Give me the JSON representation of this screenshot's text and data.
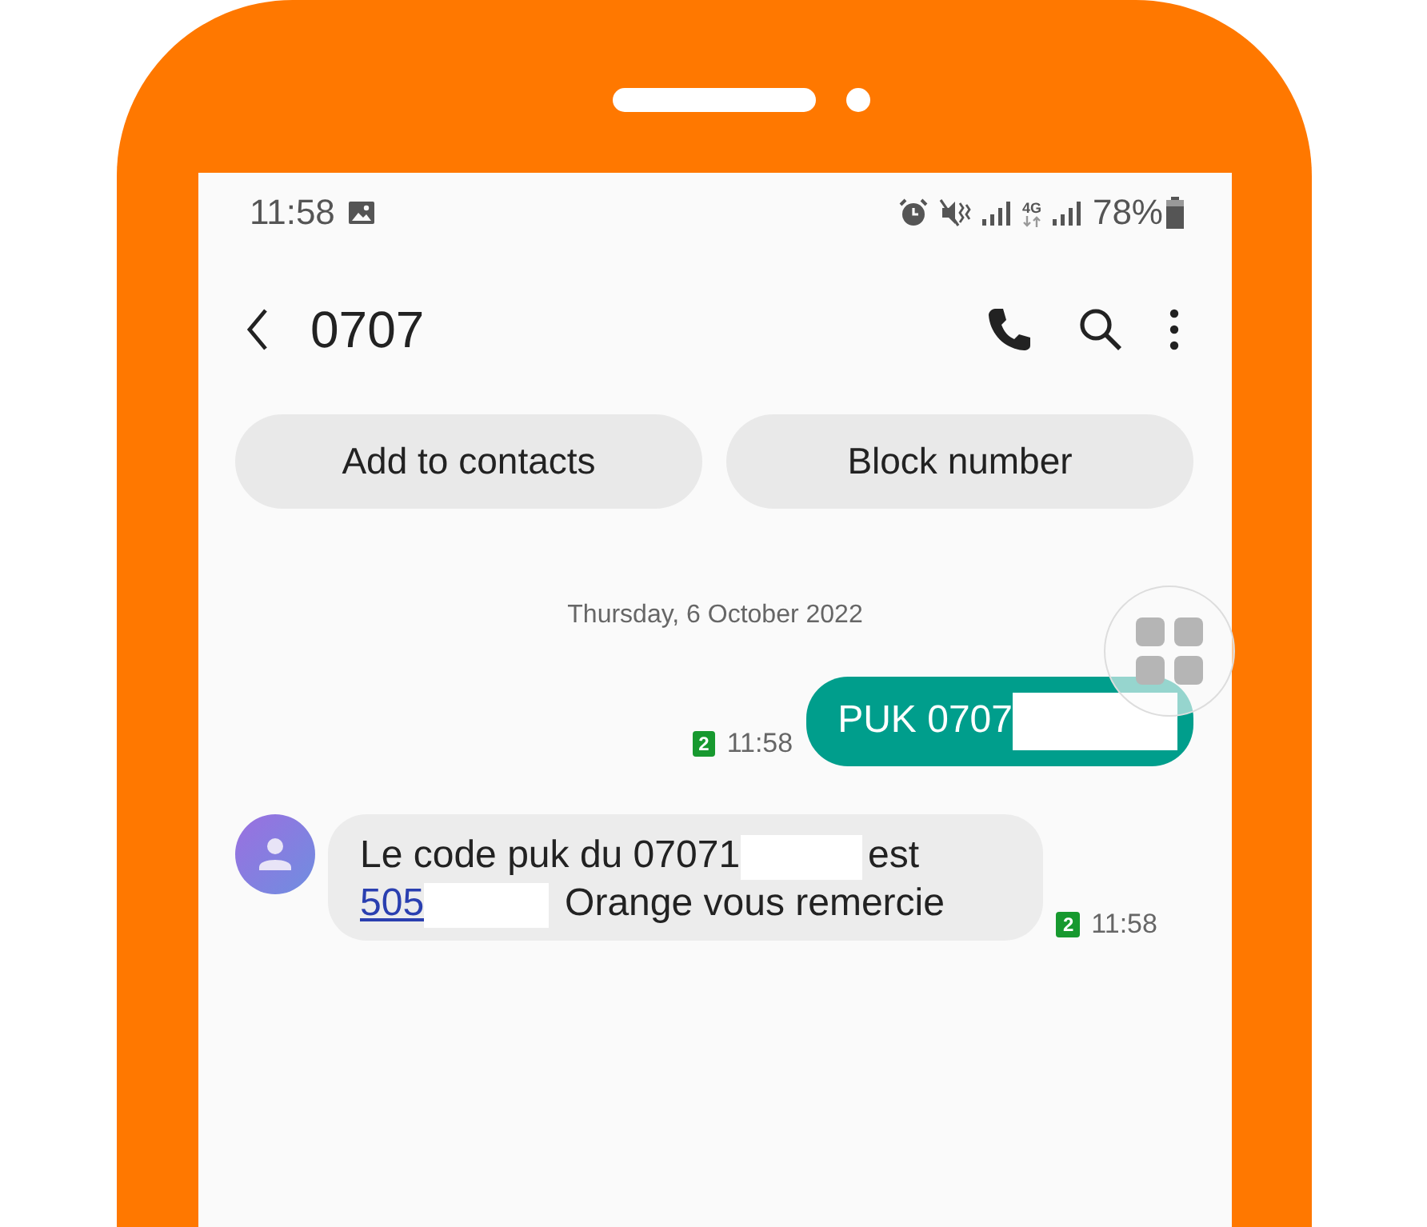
{
  "status_bar": {
    "time": "11:58",
    "network": "4G",
    "battery": "78%"
  },
  "header": {
    "title": "0707"
  },
  "actions": [
    {
      "label": "Add to contacts"
    },
    {
      "label": "Block number"
    }
  ],
  "date_separator": "Thursday, 6 October 2022",
  "messages": [
    {
      "kind": "sent",
      "sim": "2",
      "time": "11:58",
      "lines": [
        [
          {
            "kind": "text",
            "text": "PUK 0707"
          },
          {
            "kind": "redacted"
          }
        ]
      ]
    },
    {
      "kind": "received",
      "sim": "2",
      "time": "11:58",
      "lines": [
        [
          {
            "kind": "text",
            "text": "Le code puk du 07071"
          },
          {
            "kind": "redacted"
          },
          {
            "kind": "text",
            "text": "est"
          }
        ],
        [
          {
            "kind": "link",
            "text": "505"
          },
          {
            "kind": "redacted"
          },
          {
            "kind": "text",
            "text": "Orange vous remercie"
          }
        ]
      ]
    }
  ]
}
